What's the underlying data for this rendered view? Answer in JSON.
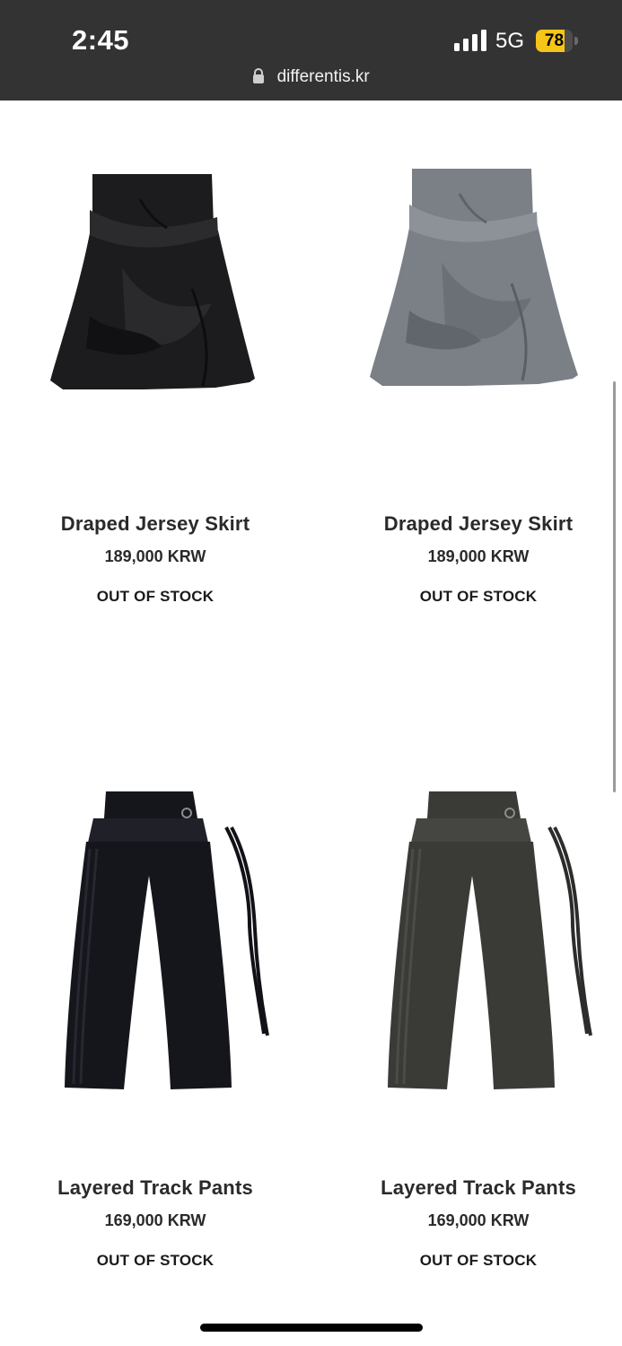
{
  "status_bar": {
    "time": "2:45",
    "network": "5G",
    "battery_percent": 78,
    "battery_label": "78"
  },
  "browser": {
    "url": "differentis.kr"
  },
  "products": [
    {
      "name": "Draped Jersey Skirt",
      "price": "189,000 KRW",
      "stock": "OUT OF STOCK",
      "color": "#1c1c1e"
    },
    {
      "name": "Draped Jersey Skirt",
      "price": "189,000 KRW",
      "stock": "OUT OF STOCK",
      "color": "#7b8087"
    },
    {
      "name": "Layered Track Pants",
      "price": "169,000 KRW",
      "stock": "OUT OF STOCK",
      "color": "#15161c"
    },
    {
      "name": "Layered Track Pants",
      "price": "169,000 KRW",
      "stock": "OUT OF STOCK",
      "color": "#3a3a37"
    }
  ],
  "colors": {
    "status_bar": "#333333",
    "battery": "#f5c518"
  }
}
